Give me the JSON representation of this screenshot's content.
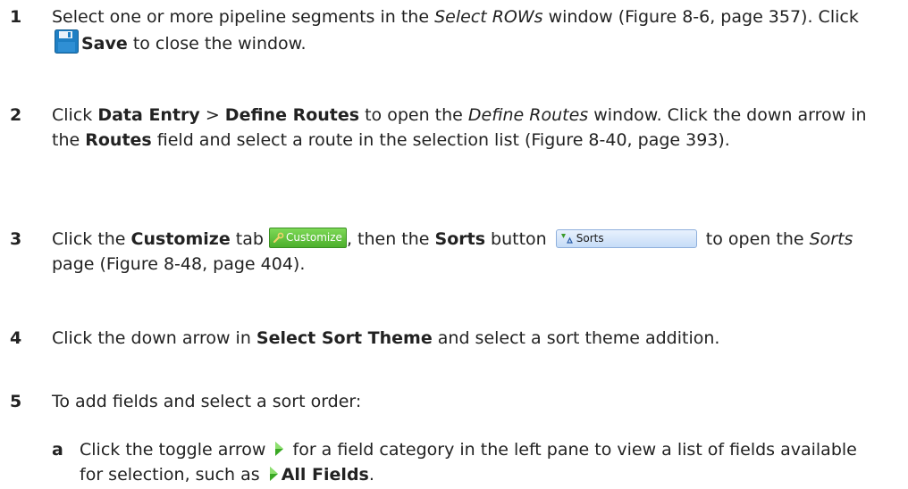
{
  "steps": [
    {
      "number": "1",
      "t1": "Select one or more pipeline segments in the ",
      "t2": "Select ROWs",
      "t3": " window (Figure 8-6, page 357). Click ",
      "t4": "Save",
      "t5": " to close the window."
    },
    {
      "number": "2",
      "t1": "Click ",
      "t2": "Data Entry",
      "t3": " > ",
      "t4": "Define Routes",
      "t5": " to open the ",
      "t6": "Define Routes",
      "t7": " window. Click the down arrow in the ",
      "t8": "Routes",
      "t9": " field and select a route in the selection list (Figure 8-40, page 393)."
    },
    {
      "number": "3",
      "t1": "Click the ",
      "t2": "Customize",
      "t3": " tab ",
      "t4": ", then the ",
      "t5": "Sorts",
      "t6": " button ",
      "t7": " to open the ",
      "t8": "Sorts",
      "t9": " page (Figure 8-48, page 404).",
      "customize_tab_label": "Customize",
      "sorts_button_label": "Sorts"
    },
    {
      "number": "4",
      "t1": "Click the down arrow in ",
      "t2": "Select Sort Theme",
      "t3": " and select a sort theme addition."
    },
    {
      "number": "5",
      "t1": "To add fields and select a sort order:"
    }
  ],
  "substeps": [
    {
      "letter": "a",
      "t1": "Click the toggle arrow ",
      "t2": " for a field category in the left pane to view a list of fields available for selection, such as ",
      "t3": "All Fields",
      "t4": "."
    }
  ],
  "icons": {
    "save": "floppy-disk-icon",
    "customize": "wrench-icon",
    "sorts": "sort-filter-icon",
    "toggle": "green-triangle-arrow-icon"
  },
  "colors": {
    "text": "#222222",
    "customize_tab": "#4caf2c",
    "sorts_button": "#c6dcf7",
    "save_icon": "#1e7fc4",
    "toggle_arrow": "#3aa824"
  }
}
